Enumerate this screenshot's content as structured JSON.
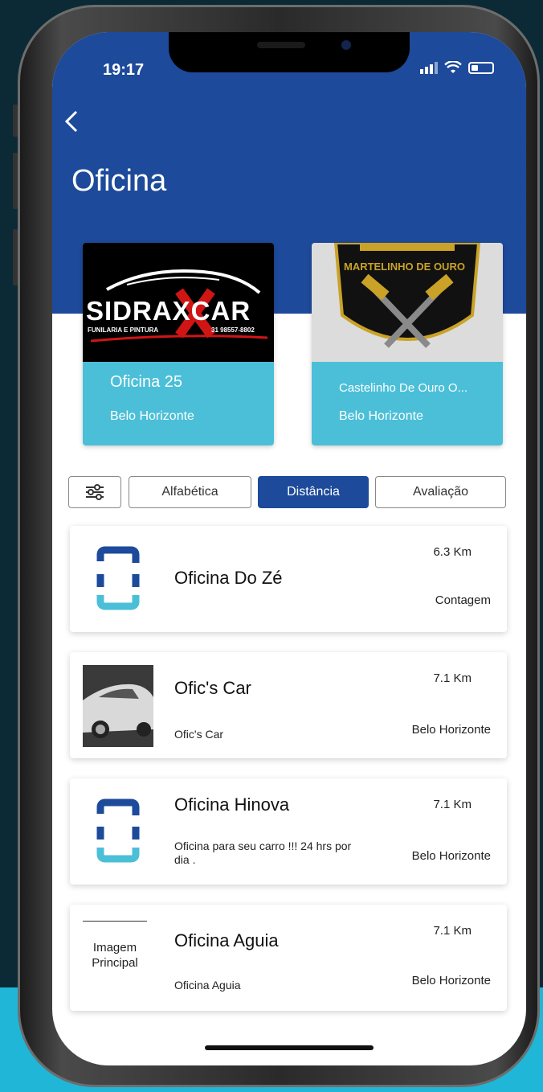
{
  "status_bar": {
    "time": "19:17",
    "signal_icon": "signal-icon",
    "wifi_icon": "wifi-icon",
    "battery_icon": "battery-icon"
  },
  "header": {
    "back_icon": "chevron-left-icon",
    "title": "Oficina"
  },
  "featured": [
    {
      "logo_text": "SIDRAXCAR",
      "logo_sub": "FUNILARIA E PINTURA",
      "logo_phone": "31 98557-8802",
      "title": "Oficina 25",
      "city": "Belo Horizonte"
    },
    {
      "logo_text": "MARTELINHO DE OURO",
      "title": "Castelinho De Ouro O...",
      "city": "Belo Horizonte"
    }
  ],
  "filters": {
    "settings_icon": "sliders-icon",
    "options": [
      "Alfabética",
      "Distância",
      "Avaliação"
    ],
    "selected": "Distância"
  },
  "list": [
    {
      "name": "Oficina Do Zé",
      "description": "",
      "distance": "6.3 Km",
      "city": "Contagem",
      "thumb": "logo"
    },
    {
      "name": "Ofic's Car",
      "description": "Ofic's Car",
      "distance": "7.1 Km",
      "city": "Belo Horizonte",
      "thumb": "car-photo"
    },
    {
      "name": "Oficina Hinova",
      "description": "Oficina para seu carro !!! 24 hrs por dia .",
      "distance": "7.1 Km",
      "city": "Belo Horizonte",
      "thumb": "logo"
    },
    {
      "name": "Oficina Aguia",
      "description": "Oficina Aguia",
      "distance": "7.1 Km",
      "city": "Belo Horizonte",
      "thumb": "placeholder",
      "placeholder_text": "Imagem Principal"
    }
  ],
  "colors": {
    "primary": "#1d4a9a",
    "accent": "#4bbfd8"
  }
}
